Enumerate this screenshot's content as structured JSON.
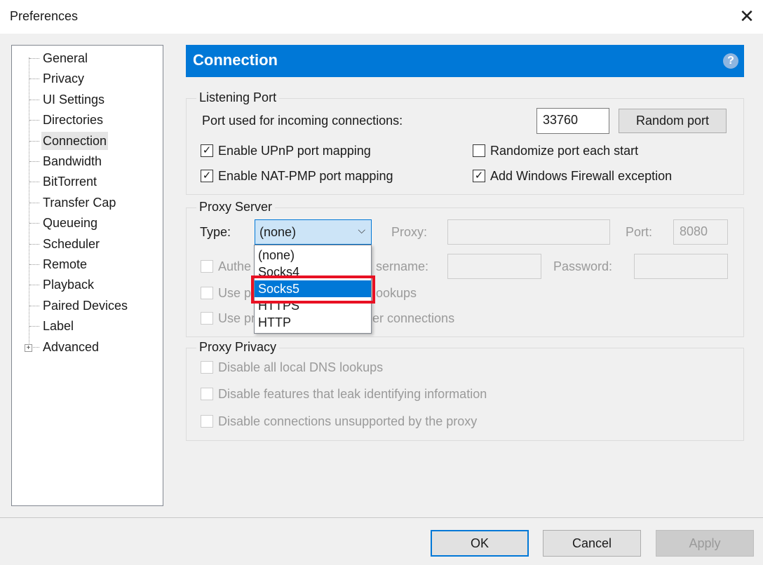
{
  "window": {
    "title": "Preferences",
    "close_icon": "close-icon"
  },
  "sidebar": {
    "items": [
      {
        "label": "General"
      },
      {
        "label": "Privacy"
      },
      {
        "label": "UI Settings"
      },
      {
        "label": "Directories"
      },
      {
        "label": "Connection",
        "selected": true
      },
      {
        "label": "Bandwidth"
      },
      {
        "label": "BitTorrent"
      },
      {
        "label": "Transfer Cap"
      },
      {
        "label": "Queueing"
      },
      {
        "label": "Scheduler"
      },
      {
        "label": "Remote"
      },
      {
        "label": "Playback"
      },
      {
        "label": "Paired Devices"
      },
      {
        "label": "Label"
      },
      {
        "label": "Advanced",
        "expandable": true
      }
    ]
  },
  "header": {
    "title": "Connection",
    "help_icon": "help-icon",
    "color": "#0078d7"
  },
  "listening_port": {
    "label": "Listening Port",
    "port_label": "Port used for incoming connections:",
    "port_value": "33760",
    "random_port": "Random port",
    "upnp": {
      "label": "Enable UPnP port mapping",
      "checked": true
    },
    "natpmp": {
      "label": "Enable NAT-PMP port mapping",
      "checked": true
    },
    "randomize": {
      "label": "Randomize port each start",
      "checked": false
    },
    "firewall": {
      "label": "Add Windows Firewall exception",
      "checked": true
    }
  },
  "proxy_server": {
    "label": "Proxy Server",
    "type_label": "Type:",
    "type_value": "(none)",
    "options": [
      "(none)",
      "Socks4",
      "Socks5",
      "HTTPS",
      "HTTP"
    ],
    "highlighted": "Socks5",
    "proxy_label": "Proxy:",
    "port_label": "Port:",
    "port_value": "8080",
    "auth_visible": "Authe",
    "username_visible": "sername:",
    "password_label": "Password:",
    "use1_visible_a": "Use p",
    "use1_visible_b": "ookups",
    "use2_visible_a": "Use pr",
    "use2_visible_b": "er connections"
  },
  "proxy_privacy": {
    "label": "Proxy Privacy",
    "items": [
      "Disable all local DNS lookups",
      "Disable features that leak identifying information",
      "Disable connections unsupported by the proxy"
    ]
  },
  "footer": {
    "ok": "OK",
    "cancel": "Cancel",
    "apply": "Apply"
  }
}
